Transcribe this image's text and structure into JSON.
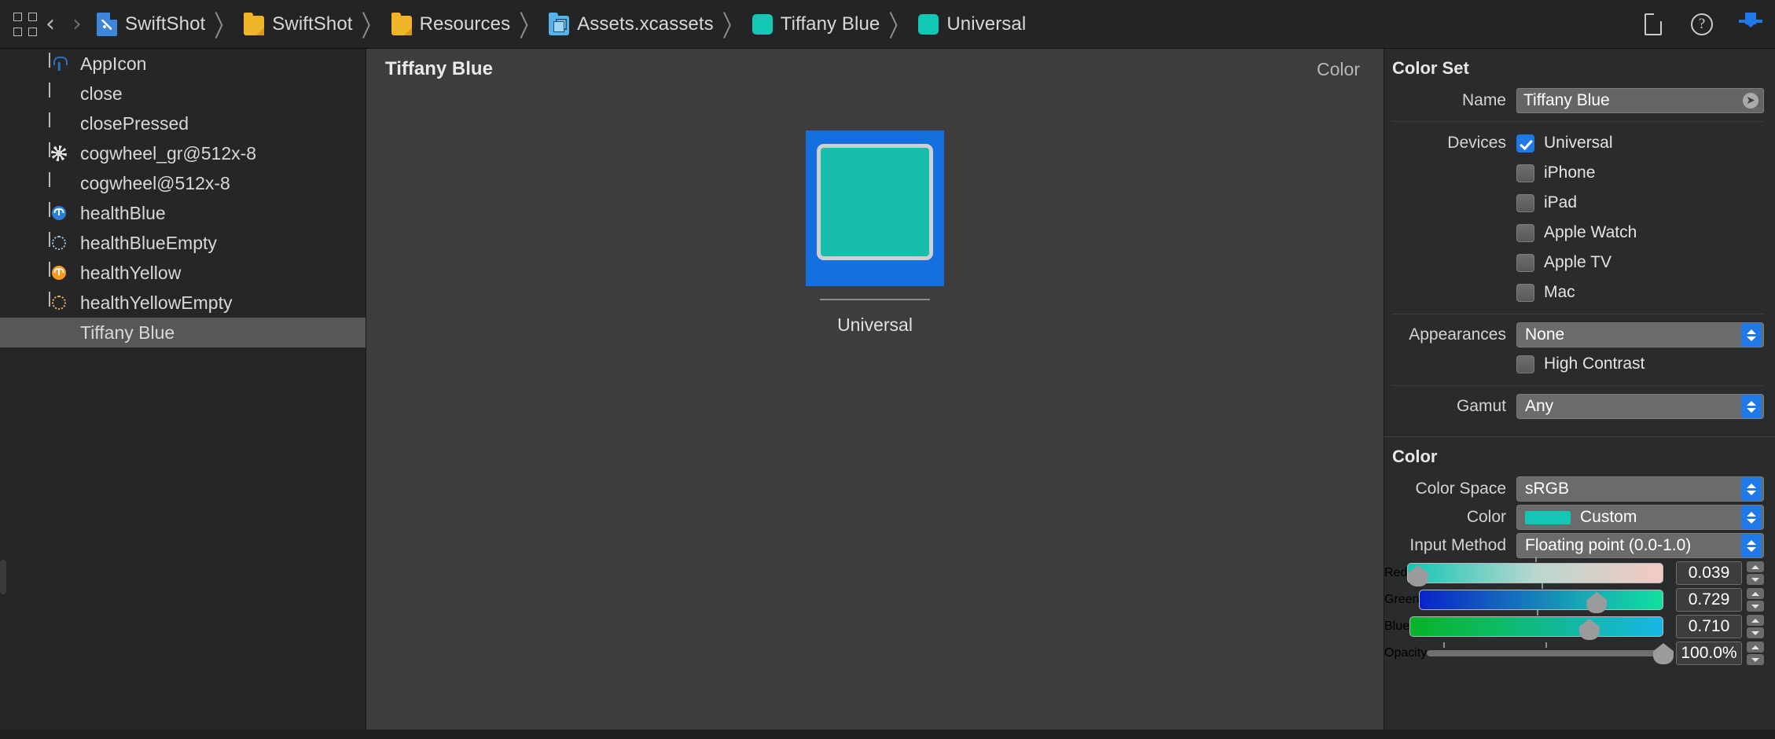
{
  "window": {
    "background": "#2b2b2b"
  },
  "toolbar": {
    "jump_bar_icon": "grid-icon",
    "back_label": "‹",
    "forward_label": "›",
    "separator": "〉",
    "breadcrumbs": [
      {
        "label": "SwiftShot",
        "icon": "swift-file-icon"
      },
      {
        "label": "SwiftShot",
        "icon": "folder-icon"
      },
      {
        "label": "Resources",
        "icon": "folder-icon"
      },
      {
        "label": "Assets.xcassets",
        "icon": "asset-catalog-icon"
      },
      {
        "label": "Tiffany Blue",
        "icon": "color-swatch-icon",
        "swatch": "#13c7b5"
      },
      {
        "label": "Universal",
        "icon": "color-swatch-icon",
        "swatch": "#13c7b5"
      }
    ],
    "inspector_buttons": [
      {
        "name": "file-inspector-icon"
      },
      {
        "name": "quick-help-icon",
        "glyph": "?"
      },
      {
        "name": "download-arrow-icon"
      }
    ]
  },
  "sidebar": {
    "assets": [
      {
        "name": "AppIcon",
        "thumb": "app-icon"
      },
      {
        "name": "close",
        "thumb": "blank-image"
      },
      {
        "name": "closePressed",
        "thumb": "blank-image"
      },
      {
        "name": "cogwheel_gr@512x-8",
        "thumb": "cogwheel-image"
      },
      {
        "name": "cogwheel@512x-8",
        "thumb": "blank-image"
      },
      {
        "name": "healthBlue",
        "thumb": "health-blue-image",
        "color": "#2b7fd4"
      },
      {
        "name": "healthBlueEmpty",
        "thumb": "health-blue-empty-image",
        "color": "#9fc7ea"
      },
      {
        "name": "healthYellow",
        "thumb": "health-yellow-image",
        "color": "#f59a1e"
      },
      {
        "name": "healthYellowEmpty",
        "thumb": "health-yellow-empty-image",
        "color": "#f0b36a"
      },
      {
        "name": "Tiffany Blue",
        "thumb": "color-swatch",
        "color": "#13c7b5",
        "selected": true
      }
    ]
  },
  "canvas": {
    "title": "Tiffany Blue",
    "kind": "Color",
    "tile": {
      "caption": "Universal",
      "swatch_color": "#18bdae",
      "selection_color": "#1470e0"
    }
  },
  "inspector": {
    "color_set": {
      "section_title": "Color Set",
      "name_label": "Name",
      "name_value": "Tiffany Blue",
      "devices_label": "Devices",
      "devices": [
        {
          "label": "Universal",
          "checked": true
        },
        {
          "label": "iPhone",
          "checked": false
        },
        {
          "label": "iPad",
          "checked": false
        },
        {
          "label": "Apple Watch",
          "checked": false
        },
        {
          "label": "Apple TV",
          "checked": false
        },
        {
          "label": "Mac",
          "checked": false
        }
      ],
      "appearances_label": "Appearances",
      "appearances_value": "None",
      "high_contrast_label": "High Contrast",
      "high_contrast_checked": false,
      "gamut_label": "Gamut",
      "gamut_value": "Any"
    },
    "color": {
      "section_title": "Color",
      "color_space_label": "Color Space",
      "color_space_value": "sRGB",
      "color_label": "Color",
      "color_value": "Custom",
      "color_chip": "#13c7b5",
      "input_method_label": "Input Method",
      "input_method_value": "Floating point (0.0-1.0)",
      "channels": [
        {
          "label": "Red",
          "value": "0.039",
          "position": 3.9
        },
        {
          "label": "Green",
          "value": "0.729",
          "position": 72.9
        },
        {
          "label": "Blue",
          "value": "0.710",
          "position": 71.0
        },
        {
          "label": "Opacity",
          "value": "100.0%",
          "position": 100
        }
      ]
    }
  }
}
